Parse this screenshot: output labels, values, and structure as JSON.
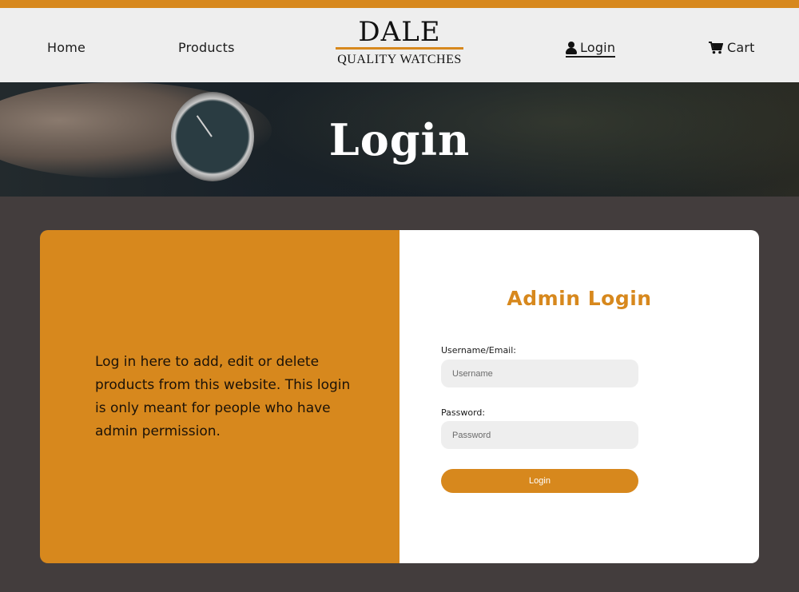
{
  "nav": {
    "home_label": "Home",
    "products_label": "Products",
    "login_label": "Login",
    "cart_label": "Cart"
  },
  "logo": {
    "name": "DALE",
    "tagline": "QUALITY WATCHES"
  },
  "hero": {
    "title": "Login"
  },
  "info": {
    "text": "Log in here to add, edit or delete products from this website. This login is only meant for people who have admin permission."
  },
  "form": {
    "title": "Admin Login",
    "username_label": "Username/Email:",
    "username_placeholder": "Username",
    "password_label": "Password:",
    "password_placeholder": "Password",
    "submit_label": "Login"
  },
  "colors": {
    "accent": "#d7881d",
    "background": "#433d3d",
    "navbar": "#eeeeee"
  },
  "icons": {
    "login": "user-icon",
    "cart": "shopping-cart-icon"
  }
}
